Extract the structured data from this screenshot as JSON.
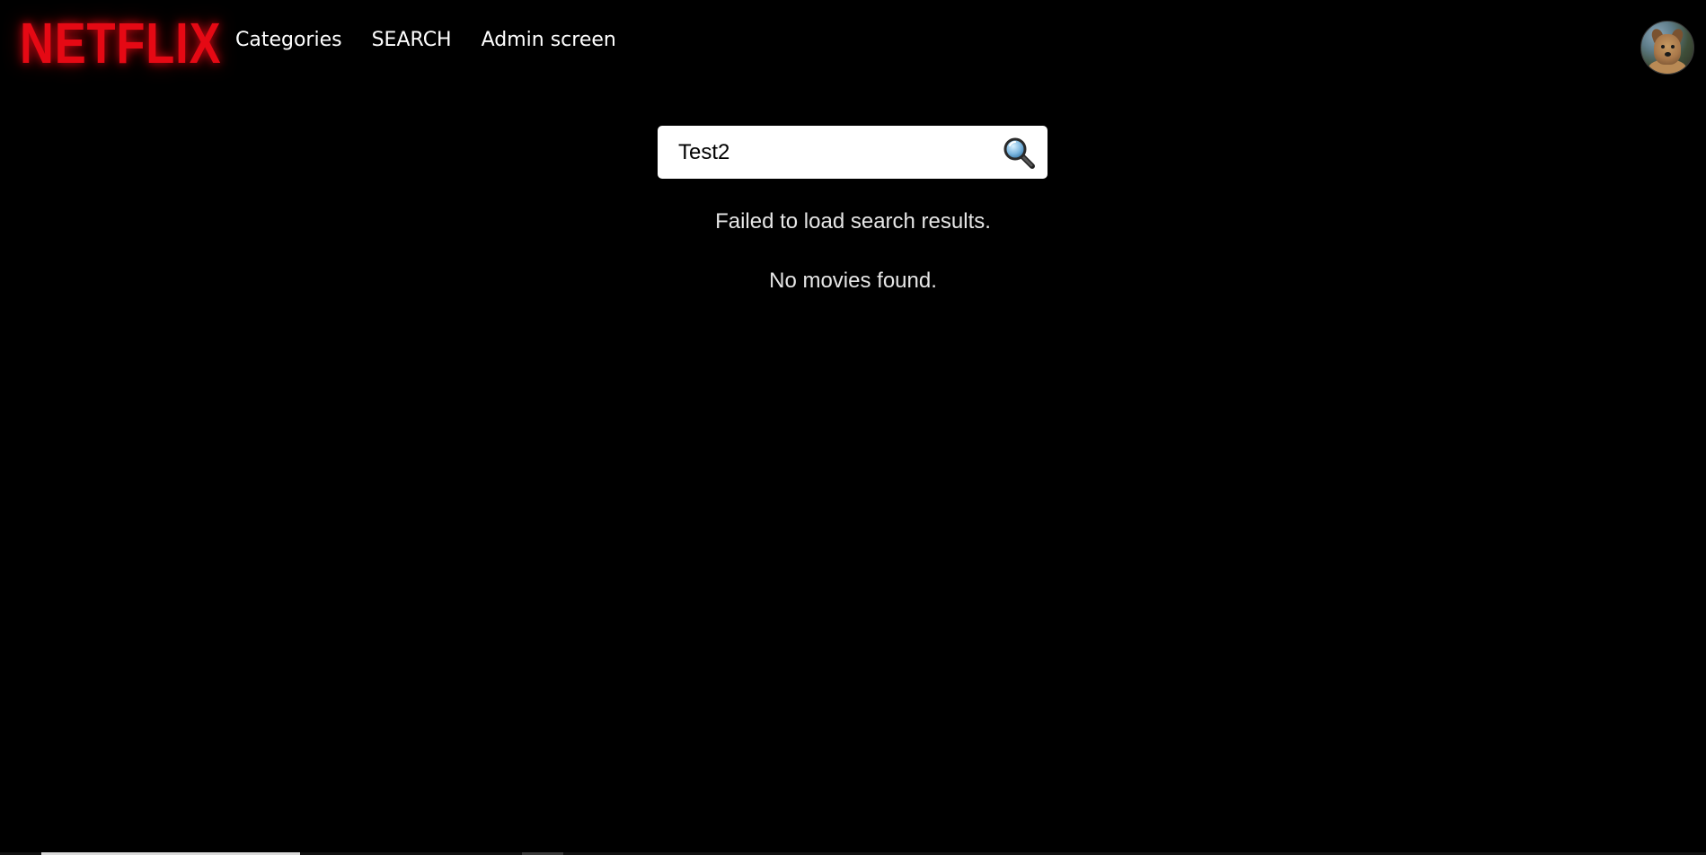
{
  "header": {
    "logo_text": "NETFLIX",
    "brand_color": "#e50914",
    "nav": {
      "categories": "Categories",
      "search": "SEARCH",
      "admin": "Admin screen"
    },
    "avatar_icon": "user-avatar-dog"
  },
  "search": {
    "value": "Test2",
    "icon": "magnifier-icon"
  },
  "messages": {
    "error": "Failed to load search results.",
    "empty": "No movies found."
  },
  "colors": {
    "background": "#000000",
    "text": "#e6e6e6",
    "input_background": "#ffffff"
  }
}
